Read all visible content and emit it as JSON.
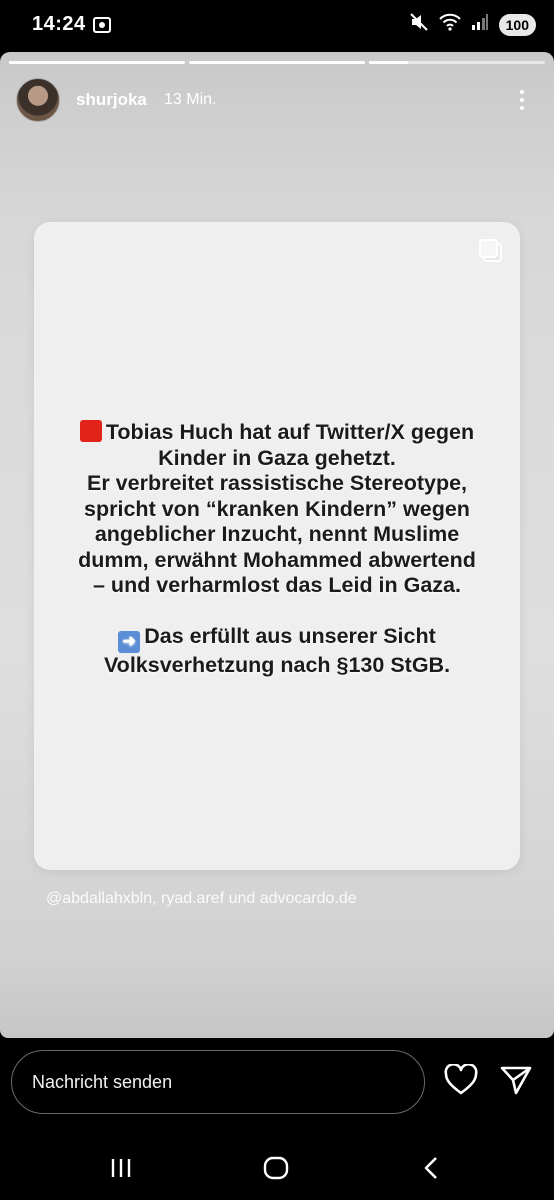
{
  "status_bar": {
    "time": "14:24",
    "battery": "100",
    "icons": [
      "screenshot-icon",
      "mute-icon",
      "wifi-icon",
      "signal-icon"
    ]
  },
  "story": {
    "progress": [
      1.0,
      1.0,
      0.22
    ],
    "username": "shurjoka",
    "time_ago": "13 Min.",
    "card_lines": [
      "Tobias Huch hat auf Twitter/X gegen",
      "Kinder in Gaza gehetzt.",
      "Er verbreitet rassistische Stereotype,",
      "spricht von “kranken Kindern” wegen",
      "angeblicher Inzucht, nennt Muslime",
      "dumm, erwähnt Mohammed abwertend",
      "– und verharmlost das Leid in Gaza."
    ],
    "card_lines_2": [
      "Das erfüllt aus unserer Sicht",
      "Volksverhetzung nach §130 StGB."
    ],
    "mentions": "@abdallahxbln, ryad.aref und advocardo.de"
  },
  "reply_bar": {
    "placeholder": "Nachricht senden"
  },
  "colors": {
    "red_square": "#e2231a",
    "arrow_emoji": "#5b8ed4"
  }
}
